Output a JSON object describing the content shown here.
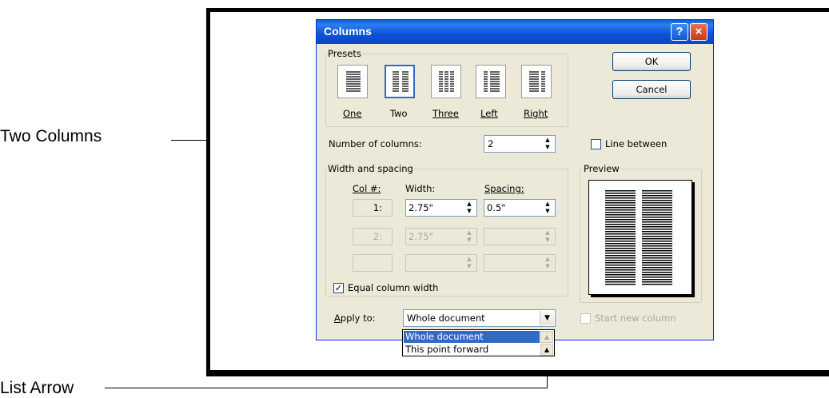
{
  "callouts": {
    "two_columns": "Two Columns",
    "list_arrow": "List Arrow"
  },
  "dialog": {
    "title": "Columns",
    "help_glyph": "?",
    "close_glyph": "×",
    "presets_group": "Presets",
    "presets": [
      {
        "label": "One",
        "hotkey_index": 0
      },
      {
        "label": "Two",
        "hotkey_index": 1
      },
      {
        "label": "Three",
        "hotkey_index": 0
      },
      {
        "label": "Left",
        "hotkey_index": 0
      },
      {
        "label": "Right",
        "hotkey_index": 0
      }
    ],
    "ok_label": "OK",
    "cancel_label": "Cancel",
    "number_label": "Number of columns:",
    "number_value": "2",
    "line_between_label": "Line between",
    "line_between_checked": false,
    "width_spacing_group": "Width and spacing",
    "col_header": "Col #:",
    "width_header": "Width:",
    "spacing_header": "Spacing:",
    "rows": [
      {
        "col": "1:",
        "width": "2.75\"",
        "spacing": "0.5\"",
        "enabled": true
      },
      {
        "col": "2:",
        "width": "2.75\"",
        "spacing": "",
        "enabled": false
      },
      {
        "col": "",
        "width": "",
        "spacing": "",
        "enabled": false
      }
    ],
    "equal_width_label": "Equal column width",
    "equal_width_checked": true,
    "preview_group": "Preview",
    "apply_label": "Apply to:",
    "apply_value": "Whole document",
    "apply_options": [
      "Whole document",
      "This point forward"
    ],
    "start_new_column_label": "Start new column",
    "start_new_column_checked": false
  },
  "colors": {
    "titlebar": "#0a52d6",
    "dialog_bg": "#ece9d8",
    "selection": "#316ac5"
  }
}
